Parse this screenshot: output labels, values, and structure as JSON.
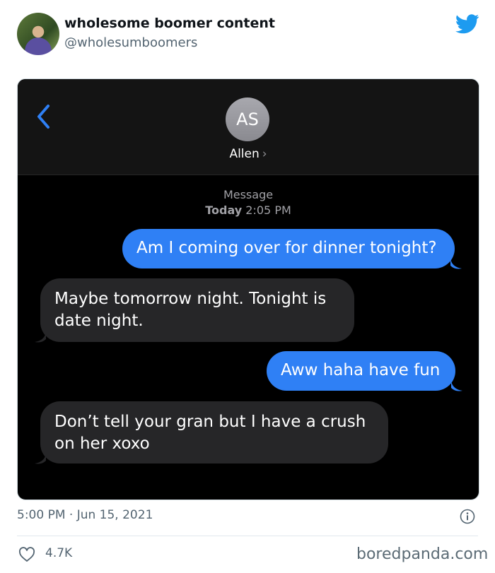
{
  "tweet": {
    "display_name": "wholesome boomer content",
    "handle": "@wholesumboomers",
    "time": "5:00 PM · Jun 15, 2021",
    "likes": "4.7K",
    "icons": {
      "twitter": "twitter-bird-icon",
      "info": "info-icon",
      "like": "heart-icon"
    },
    "colors": {
      "twitter_blue": "#1d9bf0",
      "text_secondary": "#536471"
    }
  },
  "imessage": {
    "contact_initials": "AS",
    "contact_name": "Allen",
    "contact_chevron": "›",
    "service_label": "Message",
    "day_label": "Today",
    "time_label": "2:05 PM",
    "colors": {
      "sent_bubble": "#2f80f5",
      "received_bubble": "#262628",
      "back_chevron": "#2f80f5"
    },
    "messages": [
      {
        "direction": "sent",
        "text": "Am I coming over for dinner tonight?"
      },
      {
        "direction": "received",
        "text": "Maybe tomorrow night. Tonight is date night."
      },
      {
        "direction": "sent",
        "text": "Aww haha have fun"
      },
      {
        "direction": "received",
        "text": "Don’t tell your gran but I have a crush on her xoxo"
      }
    ]
  },
  "watermark": "boredpanda.com"
}
